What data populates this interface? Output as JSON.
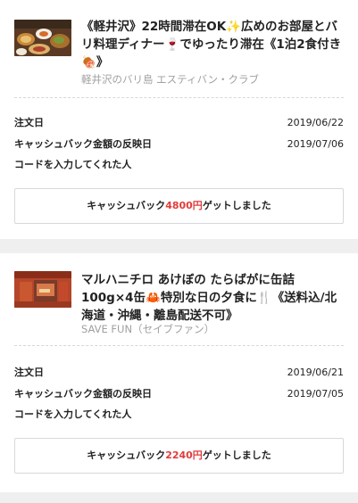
{
  "orders": [
    {
      "title_a": "《軽井沢》22時間滞在OK",
      "title_b": "広めのお部屋とバリ料理ディナー",
      "title_c": "でゆったり滞在《1泊2食付き",
      "title_d": "》",
      "shop": "軽井沢のバリ島 エスティバン・クラブ",
      "rows": [
        {
          "label": "注文日",
          "value": "2019/06/22"
        },
        {
          "label": "キャッシュバック金額の反映日",
          "value": "2019/07/06"
        },
        {
          "label": "コードを入力してくれた人",
          "value": ""
        }
      ],
      "cashback_prefix": "キャッシュバック",
      "cashback_amount": "4800円",
      "cashback_suffix": "ゲットしました"
    },
    {
      "title_a": "マルハニチロ あけぼの たらばがに缶詰100g×4缶",
      "title_b": "特別な日の夕食に",
      "title_c": "《送料込/北海道・沖縄・離島配送不可》",
      "shop": "SAVE FUN（セイブファン）",
      "rows": [
        {
          "label": "注文日",
          "value": "2019/06/21"
        },
        {
          "label": "キャッシュバック金額の反映日",
          "value": "2019/07/05"
        },
        {
          "label": "コードを入力してくれた人",
          "value": ""
        }
      ],
      "cashback_prefix": "キャッシュバック",
      "cashback_amount": "2240円",
      "cashback_suffix": "ゲットしました"
    }
  ],
  "icons": {
    "sparkle": "✨",
    "wine": "🍷",
    "meat": "🍖",
    "crab": "🦀",
    "fork_knife": "🍴"
  },
  "colors": {
    "accent": "#e03c3c",
    "muted_text": "#a0a0a0",
    "background": "#efefef"
  }
}
